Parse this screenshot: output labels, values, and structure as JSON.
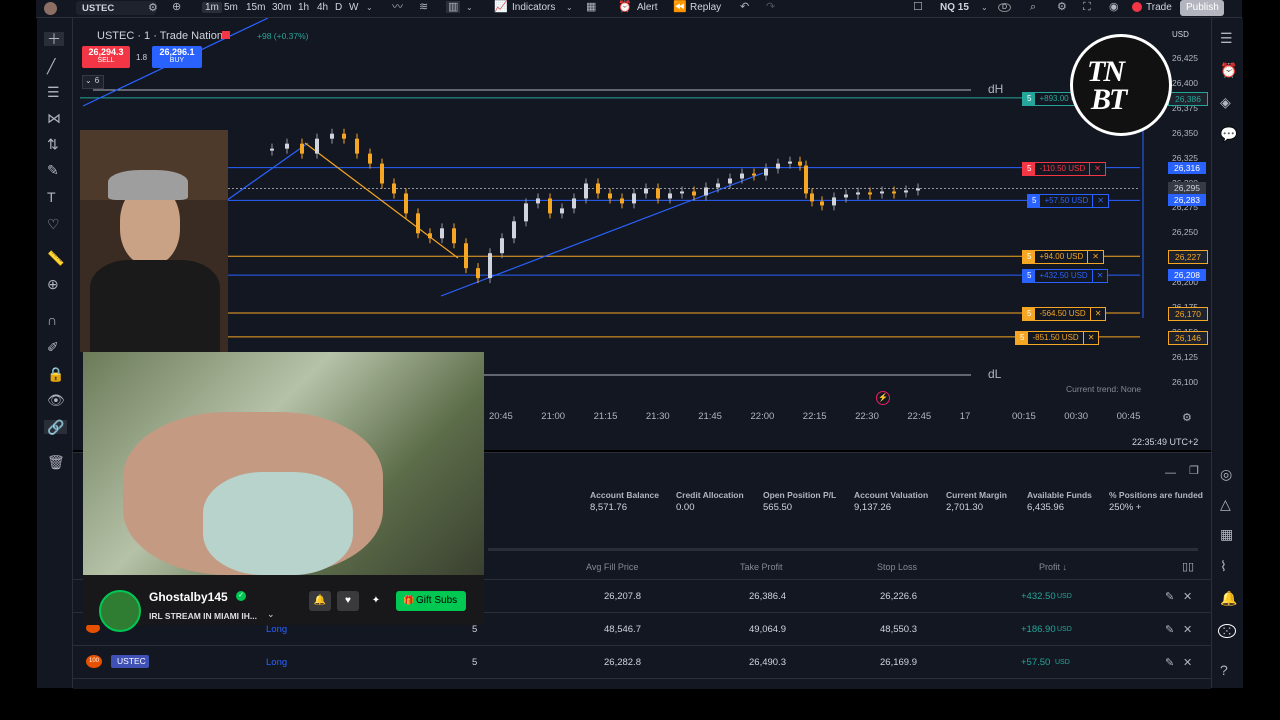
{
  "topbar": {
    "symbol": "USTEC",
    "intervals": [
      "1m",
      "5m",
      "15m",
      "30m",
      "1h",
      "4h",
      "D",
      "W"
    ],
    "indicators_label": "Indicators",
    "alert_label": "Alert",
    "replay_label": "Replay",
    "layout_name": "NQ 15",
    "d_badge": "D",
    "trade_label": "Trade",
    "publish_label": "Publish"
  },
  "chart": {
    "title": "USTEC · 1 · Trade Nation",
    "change": "+98 (+0.37%)",
    "sell_price": "26,294.3",
    "sell_label": "SELL",
    "spread": "1.8",
    "buy_price": "26,296.1",
    "buy_label": "BUY",
    "collapse_count": "6",
    "dh_label": "dH",
    "dl_label": "dL",
    "trend_label": "Current trend: None",
    "currency": "USD",
    "clock": "22:35:49 UTC+2",
    "price_axis": [
      "26,425",
      "26,400",
      "26,375",
      "26,350",
      "26,325",
      "26,300",
      "26,275",
      "26,250",
      "26,225",
      "26,200",
      "26,175",
      "26,150",
      "26,125",
      "26,100"
    ],
    "price_tags": [
      {
        "value": "26,386",
        "color": "#1e222d",
        "text_color": "#26a69a"
      },
      {
        "value": "26,316",
        "color": "#2962ff",
        "text_color": "#ffffff"
      },
      {
        "value": "26,295",
        "color": "#363a45",
        "text_color": "#d1d4dc"
      },
      {
        "value": "26,283",
        "color": "#2962ff",
        "text_color": "#ffffff"
      },
      {
        "value": "26,227",
        "color": "#1e222d",
        "text_color": "#f5a623"
      },
      {
        "value": "26,208",
        "color": "#2962ff",
        "text_color": "#ffffff"
      },
      {
        "value": "26,170",
        "color": "#1e222d",
        "text_color": "#f5a623"
      },
      {
        "value": "26,146",
        "color": "#1e222d",
        "text_color": "#f5a623"
      }
    ],
    "orders": [
      {
        "qty": "5",
        "pl": "+893.00 USD",
        "color": "#26a69a"
      },
      {
        "qty": "5",
        "pl": "-110.50 USD",
        "color": "#f23645"
      },
      {
        "qty": "5",
        "pl": "+57.50 USD",
        "color": "#2962ff"
      },
      {
        "qty": "5",
        "pl": "+94.00 USD",
        "color": "#f5a623"
      },
      {
        "qty": "5",
        "pl": "+432.50 USD",
        "color": "#2962ff"
      },
      {
        "qty": "5",
        "pl": "-564.50 USD",
        "color": "#f5a623"
      },
      {
        "qty": "5",
        "pl": "-851.50 USD",
        "color": "#f5a623"
      }
    ],
    "time_axis": [
      "20:45",
      "21:00",
      "21:15",
      "21:30",
      "21:45",
      "22:00",
      "22:15",
      "22:30",
      "22:45",
      "17",
      "00:15",
      "00:30",
      "00:45"
    ]
  },
  "account": {
    "headers": [
      "Account Balance",
      "Credit Allocation",
      "Open Position P/L",
      "Account Valuation",
      "Current Margin",
      "Available Funds",
      "% Positions are funded"
    ],
    "values": [
      "8,571.76",
      "0.00",
      "565.50",
      "9,137.26",
      "2,701.30",
      "6,435.96",
      "250% +"
    ]
  },
  "positions": {
    "headers": [
      "Avg Fill Price",
      "Take Profit",
      "Stop Loss",
      "Profit ↓"
    ],
    "rows": [
      {
        "symbol": "",
        "side": "",
        "qty": "",
        "avg": "26,207.8",
        "tp": "26,386.4",
        "sl": "26,226.6",
        "profit": "+432.50",
        "unit": "USD"
      },
      {
        "symbol": "",
        "side": "Long",
        "qty": "5",
        "avg": "48,546.7",
        "tp": "49,064.9",
        "sl": "48,550.3",
        "profit": "+186.90",
        "unit": "USD"
      },
      {
        "symbol": "USTEC",
        "side": "Long",
        "qty": "5",
        "avg": "26,282.8",
        "tp": "26,490.3",
        "sl": "26,169.9",
        "profit": "+57.50",
        "unit": "USD"
      }
    ]
  },
  "stream": {
    "streamer": "Ghostalby145",
    "title": "IRL STREAM IN MIAMI IH...",
    "gift_label": "Gift Subs",
    "live_badge": "LIVE"
  },
  "logo_text": "TNBT.SE",
  "colors": {
    "bg": "#131722",
    "up": "#26a69a",
    "down": "#f5a623",
    "blue": "#2962ff",
    "red": "#f23645",
    "green": "#4caf50",
    "gift": "#00c853"
  }
}
